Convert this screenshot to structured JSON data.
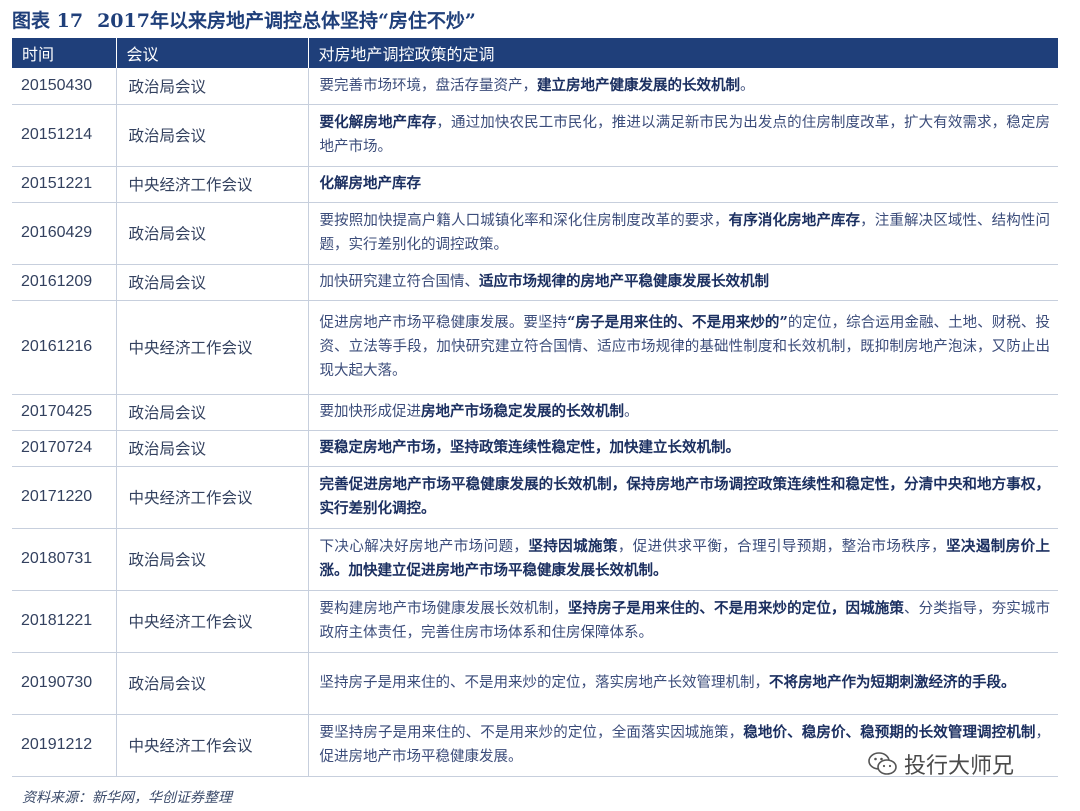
{
  "figure_label": "图表 17",
  "figure_title": "2017年以来房地产调控总体坚持“房住不炒”",
  "headers": [
    "时间",
    "会议",
    "对房地产调控政策的定调"
  ],
  "rows": [
    {
      "date": "20150430",
      "meeting": "政治局会议",
      "h": 36,
      "segments": [
        {
          "t": "要完善市场环境，盘活存量资产，",
          "b": false
        },
        {
          "t": "建立房地产健康发展的长效机制",
          "b": true
        },
        {
          "t": "。",
          "b": false
        }
      ]
    },
    {
      "date": "20151214",
      "meeting": "政治局会议",
      "h": 62,
      "segments": [
        {
          "t": "要化解房地产库存",
          "b": true
        },
        {
          "t": "，通过加快农民工市民化，推进以满足新市民为出发点的住房制度改革，扩大有效需求，稳定房地产市场。",
          "b": false
        }
      ]
    },
    {
      "date": "20151221",
      "meeting": "中央经济工作会议",
      "h": 36,
      "segments": [
        {
          "t": "化解房地产库存",
          "b": true
        }
      ]
    },
    {
      "date": "20160429",
      "meeting": "政治局会议",
      "h": 62,
      "segments": [
        {
          "t": "要按照加快提高户籍人口城镇化率和深化住房制度改革的要求，",
          "b": false
        },
        {
          "t": "有序消化房地产库存",
          "b": true
        },
        {
          "t": "，注重解决区域性、结构性问题，实行差别化的调控政策。",
          "b": false
        }
      ]
    },
    {
      "date": "20161209",
      "meeting": "政治局会议",
      "h": 36,
      "segments": [
        {
          "t": "加快研究建立符合国情、",
          "b": false
        },
        {
          "t": "适应市场规律的房地产平稳健康发展长效机制",
          "b": true
        }
      ]
    },
    {
      "date": "20161216",
      "meeting": "中央经济工作会议",
      "h": 94,
      "segments": [
        {
          "t": "促进房地产市场平稳健康发展。要坚持",
          "b": false
        },
        {
          "t": "“房子是用来住的、不是用来炒的”",
          "b": true
        },
        {
          "t": "的定位，综合运用金融、土地、财税、投资、立法等手段，加快研究建立符合国情、适应市场规律的基础性制度和长效机制，既抑制房地产泡沫，又防止出现大起大落。",
          "b": false
        }
      ]
    },
    {
      "date": "20170425",
      "meeting": "政治局会议",
      "h": 36,
      "segments": [
        {
          "t": "要加快形成促进",
          "b": false
        },
        {
          "t": "房地产市场稳定发展的长效机制",
          "b": true
        },
        {
          "t": "。",
          "b": false
        }
      ]
    },
    {
      "date": "20170724",
      "meeting": "政治局会议",
      "h": 36,
      "segments": [
        {
          "t": "要稳定房地产市场，坚持政策连续性稳定性，加快建立长效机制。",
          "b": true
        }
      ]
    },
    {
      "date": "20171220",
      "meeting": "中央经济工作会议",
      "h": 62,
      "segments": [
        {
          "t": "完善促进房地产市场平稳健康发展的长效机制，保持房地产市场调控政策连续性和稳定性，分清中央和地方事权，实行差别化调控。",
          "b": true
        }
      ]
    },
    {
      "date": "20180731",
      "meeting": "政治局会议",
      "h": 62,
      "segments": [
        {
          "t": "下决心解决好房地产市场问题，",
          "b": false
        },
        {
          "t": "坚持因城施策",
          "b": true
        },
        {
          "t": "，促进供求平衡，合理引导预期，整治市场秩序，",
          "b": false
        },
        {
          "t": "坚决遏制房价上涨。加快建立促进房地产市场平稳健康发展长效机制。",
          "b": true
        }
      ]
    },
    {
      "date": "20181221",
      "meeting": "中央经济工作会议",
      "h": 62,
      "segments": [
        {
          "t": "要构建房地产市场健康发展长效机制，",
          "b": false
        },
        {
          "t": "坚持房子是用来住的、不是用来炒的定位，因城施策",
          "b": true
        },
        {
          "t": "、分类指导，夯实城市政府主体责任，完善住房市场体系和住房保障体系。",
          "b": false
        }
      ]
    },
    {
      "date": "20190730",
      "meeting": "政治局会议",
      "h": 62,
      "segments": [
        {
          "t": "坚持房子是用来住的、不是用来炒的定位，落实房地产长效管理机制，",
          "b": false
        },
        {
          "t": "不将房地产作为短期刺激经济的手段。",
          "b": true
        }
      ]
    },
    {
      "date": "20191212",
      "meeting": "中央经济工作会议",
      "h": 62,
      "segments": [
        {
          "t": "要坚持房子是用来住的、不是用来炒的定位，全面落实因城施策，",
          "b": false
        },
        {
          "t": "稳地价、稳房价、稳预期的长效管理调控机制",
          "b": true
        },
        {
          "t": "，促进房地产市场平稳健康发展。",
          "b": false
        }
      ]
    }
  ],
  "source": "资料来源：新华网，华创证券整理",
  "watermark": "投行大师兄",
  "colors": {
    "header_bg": "#1f3f7a",
    "title": "#1f3f7a",
    "border": "#c7cfdd"
  }
}
